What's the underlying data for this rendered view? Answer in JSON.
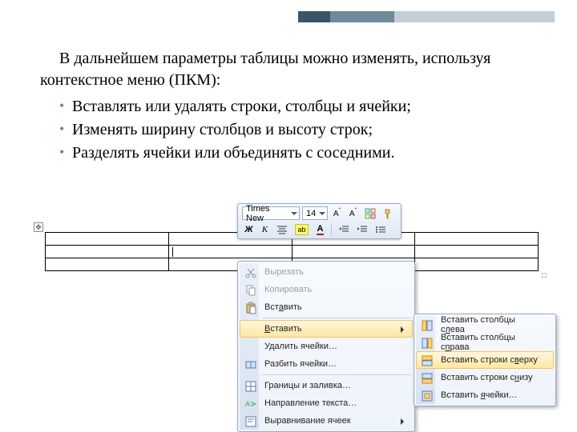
{
  "intro": "В дальнейшем параметры таблицы можно изменять, используя контекстное меню (ПКМ):",
  "bullets": [
    "Вставлять или удалять строки, столбцы и ячейки;",
    "Изменять ширину столбцов и высоту строк;",
    "Разделять ячейки или объединять с соседними."
  ],
  "miniToolbar": {
    "font": "Times New",
    "size": "14"
  },
  "contextMenu": {
    "items": [
      {
        "label": "Вырезать",
        "disabled": true,
        "icon": "cut"
      },
      {
        "label": "Копировать",
        "disabled": true,
        "icon": "copy"
      },
      {
        "label": "Вставить",
        "icon": "paste",
        "accel": "а"
      },
      {
        "sep": true
      },
      {
        "label": "Вставить",
        "icon": "none",
        "submenu": true,
        "hover": true,
        "accel": "В"
      },
      {
        "label": "Удалить ячейки…",
        "icon": "none"
      },
      {
        "label": "Разбить ячейки…",
        "icon": "split"
      },
      {
        "sep": true
      },
      {
        "label": "Границы и заливка…",
        "icon": "borders"
      },
      {
        "label": "Направление текста…",
        "icon": "textdir"
      },
      {
        "label": "Выравнивание ячеек",
        "icon": "align",
        "submenu": true
      }
    ]
  },
  "submenu": {
    "items": [
      {
        "label": "Вставить столбцы слева",
        "icon": "col-left"
      },
      {
        "label": "Вставить столбцы справа",
        "icon": "col-right"
      },
      {
        "label": "Вставить строки сверху",
        "icon": "row-above",
        "hover": true
      },
      {
        "label": "Вставить строки снизу",
        "icon": "row-below"
      },
      {
        "label": "Вставить ячейки…",
        "icon": "cells"
      }
    ]
  }
}
